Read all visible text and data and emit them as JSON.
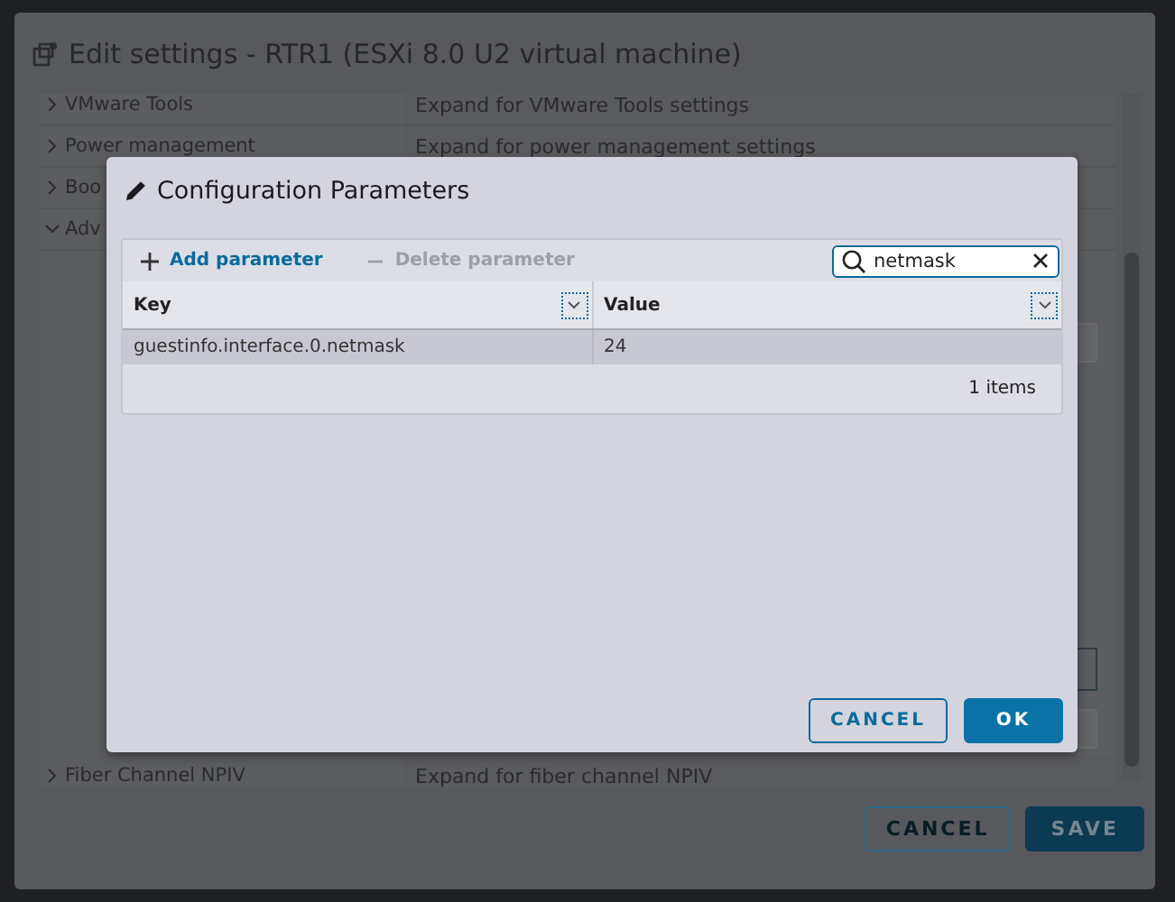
{
  "window": {
    "title": "Edit settings - RTR1 (ESXi 8.0 U2 virtual machine)"
  },
  "settings": [
    {
      "label": "VMware Tools",
      "value": "Expand for VMware Tools settings",
      "expanded": false
    },
    {
      "label": "Power management",
      "value": "Expand for power management settings",
      "expanded": false
    },
    {
      "label": "Boo",
      "expanded": false
    },
    {
      "label": "Adv",
      "expanded": true
    },
    {
      "label": "Fiber Channel NPIV",
      "value": "Expand for fiber channel NPIV",
      "expanded": false
    }
  ],
  "buttons": [
    {
      "label": "CANCEL",
      "kind": "secondary"
    },
    {
      "label": "SAVE",
      "kind": "primary"
    }
  ],
  "modal": {
    "title": "Configuration Parameters",
    "toolbar": [
      {
        "label": "Add parameter",
        "kind": "add",
        "disabled": false
      },
      {
        "label": "Delete parameter",
        "kind": "delete",
        "disabled": true
      }
    ],
    "search": {
      "value": "netmask"
    },
    "columns": [
      "Key",
      "Value"
    ],
    "rows": [
      [
        "guestinfo.interface.0.netmask",
        "24"
      ]
    ],
    "footer": "1 items",
    "buttons": [
      {
        "label": "CANCEL",
        "kind": "secondary"
      },
      {
        "label": "OK",
        "kind": "primary"
      }
    ]
  }
}
